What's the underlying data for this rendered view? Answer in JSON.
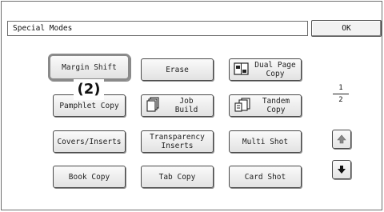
{
  "header": {
    "title": "Special Modes",
    "ok_label": "OK"
  },
  "callout": "(2)",
  "buttons": {
    "margin_shift": "Margin Shift",
    "erase": "Erase",
    "dual_page_copy": "Dual Page\nCopy",
    "pamphlet_copy": "Pamphlet Copy",
    "job_build": "Job\nBuild",
    "tandem_copy": "Tandem\nCopy",
    "covers_inserts": "Covers/Inserts",
    "transparency_inserts": "Transparency\nInserts",
    "multi_shot": "Multi Shot",
    "book_copy": "Book Copy",
    "tab_copy": "Tab Copy",
    "card_shot": "Card Shot"
  },
  "pagination": {
    "current": "1",
    "total": "2"
  },
  "icons": {
    "up": "arrow-up-icon",
    "down": "arrow-down-icon"
  }
}
